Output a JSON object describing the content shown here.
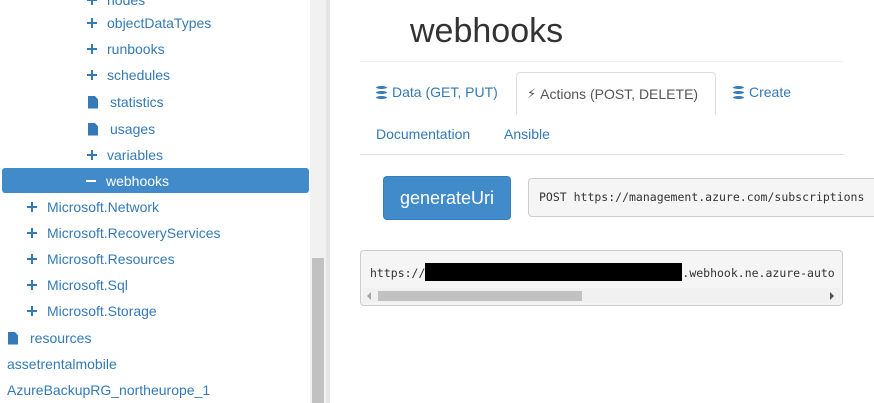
{
  "tree": {
    "items": [
      {
        "label": "nodes",
        "type": "plus"
      },
      {
        "label": "objectDataTypes",
        "type": "plus"
      },
      {
        "label": "runbooks",
        "type": "plus"
      },
      {
        "label": "schedules",
        "type": "plus"
      },
      {
        "label": "statistics",
        "type": "file"
      },
      {
        "label": "usages",
        "type": "file"
      },
      {
        "label": "variables",
        "type": "plus"
      },
      {
        "label": "webhooks",
        "type": "minus"
      },
      {
        "label": "Microsoft.Network",
        "type": "plus"
      },
      {
        "label": "Microsoft.RecoveryServices",
        "type": "plus"
      },
      {
        "label": "Microsoft.Resources",
        "type": "plus"
      },
      {
        "label": "Microsoft.Sql",
        "type": "plus"
      },
      {
        "label": "Microsoft.Storage",
        "type": "plus"
      },
      {
        "label": "resources",
        "type": "file"
      },
      {
        "label": "assetrentalmobile",
        "type": "plain"
      },
      {
        "label": "AzureBackupRG_northeurope_1",
        "type": "plain"
      }
    ]
  },
  "main": {
    "title": "webhooks",
    "tabs": [
      {
        "label": "Data (GET, PUT)",
        "icon": "database-icon"
      },
      {
        "label": "Actions (POST, DELETE)",
        "icon": "bolt-icon"
      },
      {
        "label": "Create",
        "icon": "database-icon"
      },
      {
        "label": "Documentation",
        "icon": ""
      },
      {
        "label": "Ansible",
        "icon": ""
      }
    ],
    "action_button": "generateUri",
    "request_url": "POST https://management.azure.com/subscriptions",
    "response": {
      "prefix": "https://",
      "suffix": ".webhook.ne.azure-auto"
    }
  },
  "colors": {
    "link": "#337ab7",
    "selected": "#428bca",
    "button": "#428bca"
  }
}
